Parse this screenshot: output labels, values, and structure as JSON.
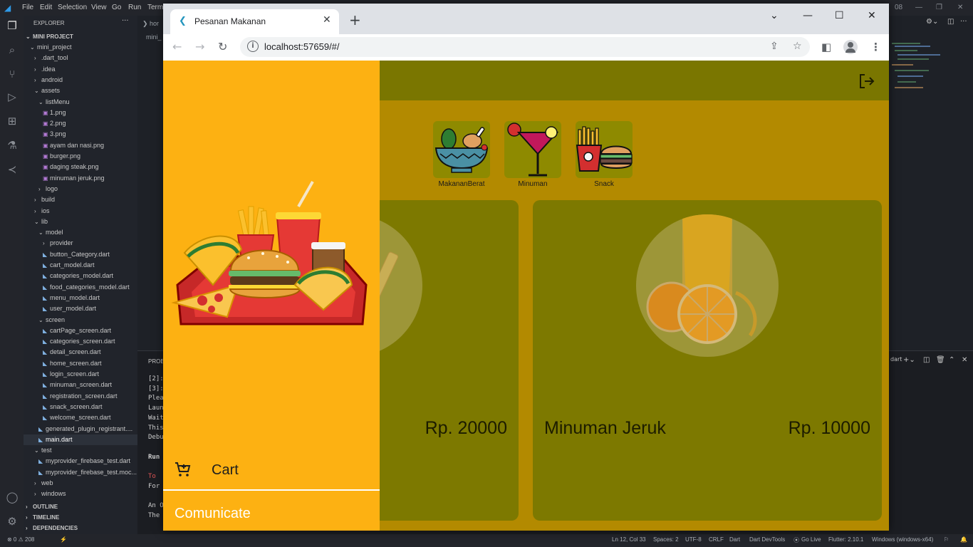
{
  "vscode": {
    "menu": [
      "File",
      "Edit",
      "Selection",
      "View",
      "Go",
      "Run",
      "Term"
    ],
    "explorer_title": "EXPLORER",
    "project_title": "MINI PROJECT",
    "tree": [
      {
        "label": "mini_project",
        "indent": 1,
        "kind": "folder-open"
      },
      {
        "label": ".dart_tool",
        "indent": 2,
        "kind": "folder"
      },
      {
        "label": ".idea",
        "indent": 2,
        "kind": "folder"
      },
      {
        "label": "android",
        "indent": 2,
        "kind": "folder"
      },
      {
        "label": "assets",
        "indent": 2,
        "kind": "folder-open"
      },
      {
        "label": "listMenu",
        "indent": 3,
        "kind": "folder-open"
      },
      {
        "label": "1.png",
        "indent": 4,
        "kind": "image"
      },
      {
        "label": "2.png",
        "indent": 4,
        "kind": "image"
      },
      {
        "label": "3.png",
        "indent": 4,
        "kind": "image"
      },
      {
        "label": "ayam dan nasi.png",
        "indent": 4,
        "kind": "image"
      },
      {
        "label": "burger.png",
        "indent": 4,
        "kind": "image"
      },
      {
        "label": "daging steak.png",
        "indent": 4,
        "kind": "image"
      },
      {
        "label": "minuman jeruk.png",
        "indent": 4,
        "kind": "image"
      },
      {
        "label": "logo",
        "indent": 3,
        "kind": "folder"
      },
      {
        "label": "build",
        "indent": 2,
        "kind": "folder"
      },
      {
        "label": "ios",
        "indent": 2,
        "kind": "folder"
      },
      {
        "label": "lib",
        "indent": 2,
        "kind": "folder-open"
      },
      {
        "label": "model",
        "indent": 3,
        "kind": "folder-open"
      },
      {
        "label": "provider",
        "indent": 4,
        "kind": "folder"
      },
      {
        "label": "button_Category.dart",
        "indent": 4,
        "kind": "dart"
      },
      {
        "label": "cart_model.dart",
        "indent": 4,
        "kind": "dart"
      },
      {
        "label": "categories_model.dart",
        "indent": 4,
        "kind": "dart"
      },
      {
        "label": "food_categories_model.dart",
        "indent": 4,
        "kind": "dart"
      },
      {
        "label": "menu_model.dart",
        "indent": 4,
        "kind": "dart"
      },
      {
        "label": "user_model.dart",
        "indent": 4,
        "kind": "dart"
      },
      {
        "label": "screen",
        "indent": 3,
        "kind": "folder-open"
      },
      {
        "label": "cartPage_screen.dart",
        "indent": 4,
        "kind": "dart"
      },
      {
        "label": "categories_screen.dart",
        "indent": 4,
        "kind": "dart"
      },
      {
        "label": "detail_screen.dart",
        "indent": 4,
        "kind": "dart"
      },
      {
        "label": "home_screen.dart",
        "indent": 4,
        "kind": "dart"
      },
      {
        "label": "login_screen.dart",
        "indent": 4,
        "kind": "dart"
      },
      {
        "label": "minuman_screen.dart",
        "indent": 4,
        "kind": "dart"
      },
      {
        "label": "registration_screen.dart",
        "indent": 4,
        "kind": "dart"
      },
      {
        "label": "snack_screen.dart",
        "indent": 4,
        "kind": "dart"
      },
      {
        "label": "welcome_screen.dart",
        "indent": 4,
        "kind": "dart"
      },
      {
        "label": "generated_plugin_registrant....",
        "indent": 3,
        "kind": "dart"
      },
      {
        "label": "main.dart",
        "indent": 3,
        "kind": "dart",
        "selected": true
      },
      {
        "label": "test",
        "indent": 2,
        "kind": "folder-open"
      },
      {
        "label": "myprovider_firebase_test.dart",
        "indent": 3,
        "kind": "dart"
      },
      {
        "label": "myprovider_firebase_test.moc...",
        "indent": 3,
        "kind": "dart"
      },
      {
        "label": "web",
        "indent": 2,
        "kind": "folder"
      },
      {
        "label": "windows",
        "indent": 2,
        "kind": "folder"
      }
    ],
    "outline_sections": [
      "OUTLINE",
      "TIMELINE",
      "DEPENDENCIES"
    ],
    "editor_tab": "hor",
    "editor_crumb": "mini_",
    "panel_tab": "PROBI",
    "terminal_lines": [
      "[2]:",
      "[3]:",
      "Plea",
      "Laun",
      "Wait",
      "This",
      "Debu",
      "",
      "Run",
      "",
      "To",
      "For",
      "",
      "An O",
      "The"
    ],
    "status": {
      "problems": "⊗ 0 ⚠ 208",
      "position": "Ln 12, Col 33",
      "spaces": "Spaces: 2",
      "encoding": "UTF-8",
      "eol": "CRLF",
      "language": "Dart",
      "devtools": "Dart DevTools",
      "golive": "Go Live",
      "flutter": "Flutter: 2.10.1",
      "device": "Windows (windows-x64)"
    },
    "panel_dropdown": "dart",
    "window_tag": "08"
  },
  "browser": {
    "tab_title": "Pesanan Makanan",
    "url": "localhost:57659/#/"
  },
  "app": {
    "categories": [
      {
        "label": "MakananBerat",
        "icon": "salad-chicken-bowl-icon"
      },
      {
        "label": "Minuman",
        "icon": "cocktail-glass-icon"
      },
      {
        "label": "Snack",
        "icon": "fries-burger-icon"
      }
    ],
    "menu_items": [
      {
        "name": "",
        "price": "Rp. 20000",
        "image": "fries-image"
      },
      {
        "name": "Minuman Jeruk",
        "price": "Rp. 10000",
        "image": "orange-juice-image"
      }
    ],
    "drawer": {
      "cart_label": "Cart",
      "communicate_label": "Comunicate"
    },
    "colors": {
      "drawer": "#fdb112",
      "scrim_app": "#b38a00",
      "appbar": "#7a7600"
    }
  }
}
